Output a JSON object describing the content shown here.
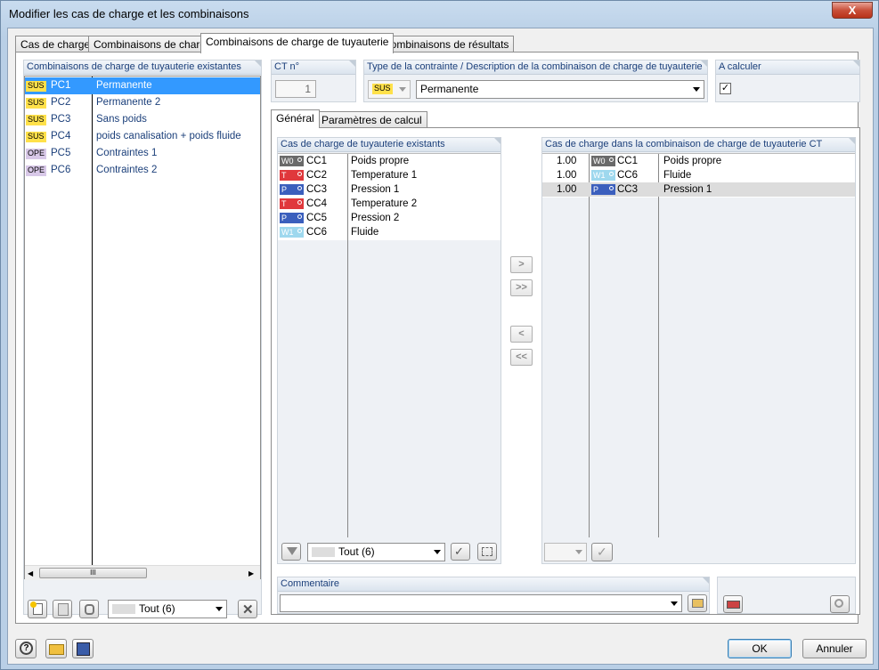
{
  "window": {
    "title": "Modifier les cas de charge et les combinaisons",
    "close_glyph": "X"
  },
  "tabs": [
    {
      "label": "Cas de charge"
    },
    {
      "label": "Combinaisons de charge"
    },
    {
      "label": "Combinaisons de charge de tuyauterie",
      "active": true
    },
    {
      "label": "Combinaisons de résultats"
    }
  ],
  "left_panel": {
    "header": "Combinaisons de charge de tuyauterie existantes",
    "items": [
      {
        "badge": "SUS",
        "id": "PC1",
        "name": "Permanente",
        "selected": true
      },
      {
        "badge": "SUS",
        "id": "PC2",
        "name": "Permanente 2"
      },
      {
        "badge": "SUS",
        "id": "PC3",
        "name": "Sans poids"
      },
      {
        "badge": "SUS",
        "id": "PC4",
        "name": "poids canalisation + poids fluide"
      },
      {
        "badge": "OPE",
        "id": "PC5",
        "name": "Contraintes 1"
      },
      {
        "badge": "OPE",
        "id": "PC6",
        "name": "Contraintes 2"
      }
    ],
    "scroll_grip": "III",
    "filter_value": "Tout (6)"
  },
  "ct": {
    "label": "CT n°",
    "value": "1"
  },
  "type": {
    "label": "Type de la contrainte / Description de la combinaison de charge de tuyauterie",
    "type_value": "SUS",
    "description": "Permanente"
  },
  "calc": {
    "label": "A calculer",
    "checked": true
  },
  "subtabs": [
    {
      "label": "Général",
      "active": true
    },
    {
      "label": "Paramètres de calcul"
    }
  ],
  "existing": {
    "header": "Cas de charge de tuyauterie existants",
    "items": [
      {
        "tag": "W0",
        "id": "CC1",
        "name": "Poids propre"
      },
      {
        "tag": "T",
        "id": "CC2",
        "name": "Temperature 1"
      },
      {
        "tag": "P",
        "id": "CC3",
        "name": "Pression 1"
      },
      {
        "tag": "T",
        "id": "CC4",
        "name": "Temperature 2"
      },
      {
        "tag": "P",
        "id": "CC5",
        "name": "Pression 2"
      },
      {
        "tag": "W1",
        "id": "CC6",
        "name": "Fluide"
      }
    ],
    "filter_value": "Tout (6)"
  },
  "in_combo": {
    "header": "Cas de charge dans la combinaison de charge de tuyauterie CT",
    "items": [
      {
        "factor": "1.00",
        "tag": "W0",
        "id": "CC1",
        "name": "Poids propre"
      },
      {
        "factor": "1.00",
        "tag": "W1",
        "id": "CC6",
        "name": "Fluide"
      },
      {
        "factor": "1.00",
        "tag": "P",
        "id": "CC3",
        "name": "Pression 1",
        "highlight": true
      }
    ]
  },
  "transfer_buttons": {
    "add_one": ">",
    "add_all": ">>",
    "remove_one": "<",
    "remove_all": "<<"
  },
  "comment": {
    "label": "Commentaire",
    "value": ""
  },
  "footer": {
    "ok": "OK",
    "cancel": "Annuler"
  },
  "colors": {
    "accent": "#3399ff",
    "header_text": "#1b3f7a",
    "sus_badge": "#ffe14a",
    "ope_badge": "#d8c8e8"
  }
}
